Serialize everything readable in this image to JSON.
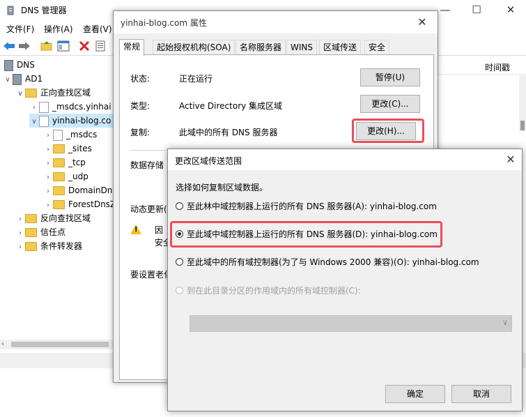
{
  "main": {
    "title": "DNS 管理器",
    "window_controls": {
      "minimize": "—",
      "maximize": "☐",
      "close": "✕"
    },
    "menu": [
      "文件(F)",
      "操作(A)",
      "查看(V)"
    ],
    "tree": [
      {
        "label": "DNS"
      },
      {
        "label": "AD1"
      },
      {
        "label": "正向查找区域"
      },
      {
        "label": "_msdcs.yinhai"
      },
      {
        "label": "yinhai-blog.co"
      },
      {
        "label": "_msdcs"
      },
      {
        "label": "_sites"
      },
      {
        "label": "_tcp"
      },
      {
        "label": "_udp"
      },
      {
        "label": "DomainDn"
      },
      {
        "label": "ForestDnsZ"
      },
      {
        "label": "反向查找区域"
      },
      {
        "label": "信任点"
      },
      {
        "label": "条件转发器"
      }
    ],
    "right_header": "时间戳"
  },
  "props": {
    "title": "yinhai-blog.com 属性",
    "close": "✕",
    "tabs": [
      "常规",
      "起始授权机构(SOA)",
      "名称服务器",
      "WINS",
      "区域传送",
      "安全"
    ],
    "status_label": "状态:",
    "status_value": "正在运行",
    "pause_button": "暂停(U)",
    "type_label": "类型:",
    "type_value": "Active Directory 集成区域",
    "type_change_button": "更改(C)...",
    "replication_label": "复制:",
    "replication_value": "此域中的所有 DNS 服务器",
    "replication_change_button": "更改(H)...",
    "data_storage_partial": "数据存储",
    "dynamic_update_partial": "动态更新(",
    "warning_line1_partial": "因",
    "warning_line2_partial": "安全",
    "aging_partial": "要设置老化"
  },
  "scope": {
    "title": "更改区域传送范围",
    "close": "✕",
    "prompt": "选择如何复制区域数据。",
    "options": [
      "至此林中域控制器上运行的所有 DNS 服务器(A): yinhai-blog.com",
      "至此域中域控制器上运行的所有 DNS 服务器(D): yinhai-blog.com",
      "至此域中的所有域控制器(为了与 Windows 2000 兼容)(O): yinhai-blog.com",
      "到在此目录分区的作用域内的所有域控制器(C):"
    ],
    "selected_option": 1,
    "ok_button": "确定",
    "cancel_button": "取消"
  },
  "colors": {
    "highlight": "#e8505b",
    "folder": "#f3c94f",
    "warning": "#f1c21b"
  }
}
